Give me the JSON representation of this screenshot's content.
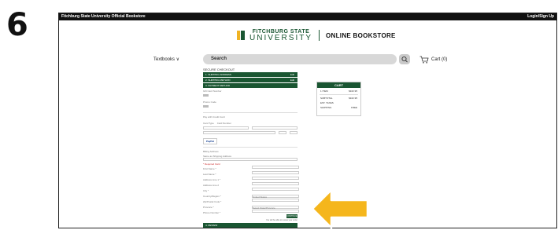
{
  "step_number": "6",
  "topbar": {
    "site_title": "Fitchburg State University Official Bookstore",
    "login": "Login/Sign Up"
  },
  "logo": {
    "line1": "FITCHBURG STATE",
    "line2": "UNIVERSITY",
    "store": "ONLINE BOOKSTORE"
  },
  "nav": {
    "textbooks": "Textbooks ∨",
    "search_placeholder": "Search",
    "cart": "Cart (0)"
  },
  "checkout": {
    "title": "SECURE CHECKOUT",
    "steps": [
      {
        "label": "1. SHIPPING ADDRESS",
        "edit": "Edit"
      },
      {
        "label": "2. SHIPPING METHOD",
        "edit": "Edit"
      },
      {
        "label": "3. PAYMENT METHOD",
        "edit": ""
      }
    ],
    "gift_card_label": "Gift Card Number",
    "promo_label": "Promo Code",
    "card_label": "Pay with Credit Card",
    "card_type": "Card Type",
    "card_number": "Card Number",
    "paypal": "PayPal",
    "billing_title": "Billing Address",
    "billing_same": "Same as Shipping Address",
    "required_note": "* Required Field",
    "fields": [
      "First Name *",
      "Last Name *",
      "Address Line 1 *",
      "Address Line 2",
      "City *",
      "Country/Region *",
      "Zip/Postal Code *",
      "Province *",
      "Phone Number *"
    ],
    "country_value": "United States",
    "province_value": "Select State/Province",
    "continue": "CONTINUE",
    "terms": "You will be able to review your order",
    "review": "4. REVIEW"
  },
  "cart_summary": {
    "title": "CART",
    "rows": [
      {
        "label": "1 ITEM",
        "value": "$162.95"
      },
      {
        "label": "SUBTOTAL",
        "value": "$162.95"
      },
      {
        "label": "EST. TAXES",
        "value": ""
      },
      {
        "label": "SHIPPING",
        "value": "FREE"
      }
    ]
  },
  "colors": {
    "brand_green": "#1a5632",
    "arrow": "#f5b61c"
  }
}
